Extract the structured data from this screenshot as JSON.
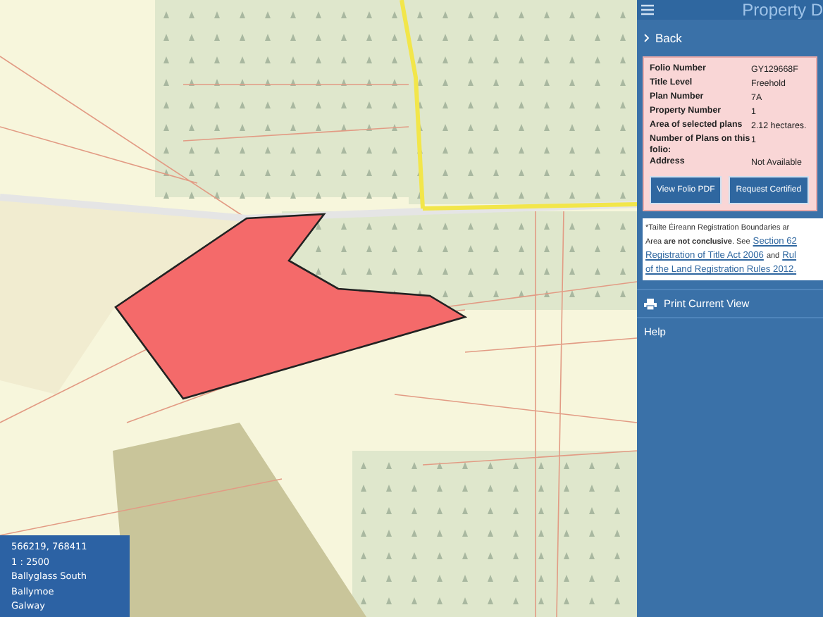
{
  "panel": {
    "title": "Property D",
    "back": "Back",
    "details": [
      {
        "label": "Folio Number",
        "value": "GY129668F"
      },
      {
        "label": "Title Level",
        "value": "Freehold"
      },
      {
        "label": "Plan Number",
        "value": "7A"
      },
      {
        "label": "Property Number",
        "value": "1"
      },
      {
        "label": "Area of selected plans",
        "value": "2.12 hectares."
      },
      {
        "label": "Number of Plans on this folio:",
        "value": "1"
      },
      {
        "label": "Address",
        "value": "Not Available"
      }
    ],
    "buttons": [
      "View Folio PDF",
      "Request Certified"
    ],
    "note_lines": [
      [
        {
          "kind": "text",
          "text": "*Tailte Éireann Registration Boundaries ar"
        }
      ],
      [
        {
          "kind": "text",
          "text": "Area **are not conclusive**. See"
        },
        {
          "kind": "link",
          "text": "Section 62"
        }
      ],
      [
        {
          "kind": "link",
          "text": "Registration of Title Act 2006"
        },
        {
          "kind": "text",
          "text": "and"
        },
        {
          "kind": "link",
          "text": "Rul"
        }
      ],
      [
        {
          "kind": "link",
          "text": "of the Land Registration Rules 2012."
        }
      ]
    ],
    "menu": [
      {
        "kind": "print",
        "label": "Print Current View"
      },
      {
        "kind": "plain",
        "label": "Help"
      }
    ]
  },
  "map_info": [
    "566219, 768411",
    "1 : 2500",
    "Ballyglass South",
    "Ballymoe",
    "Galway"
  ]
}
